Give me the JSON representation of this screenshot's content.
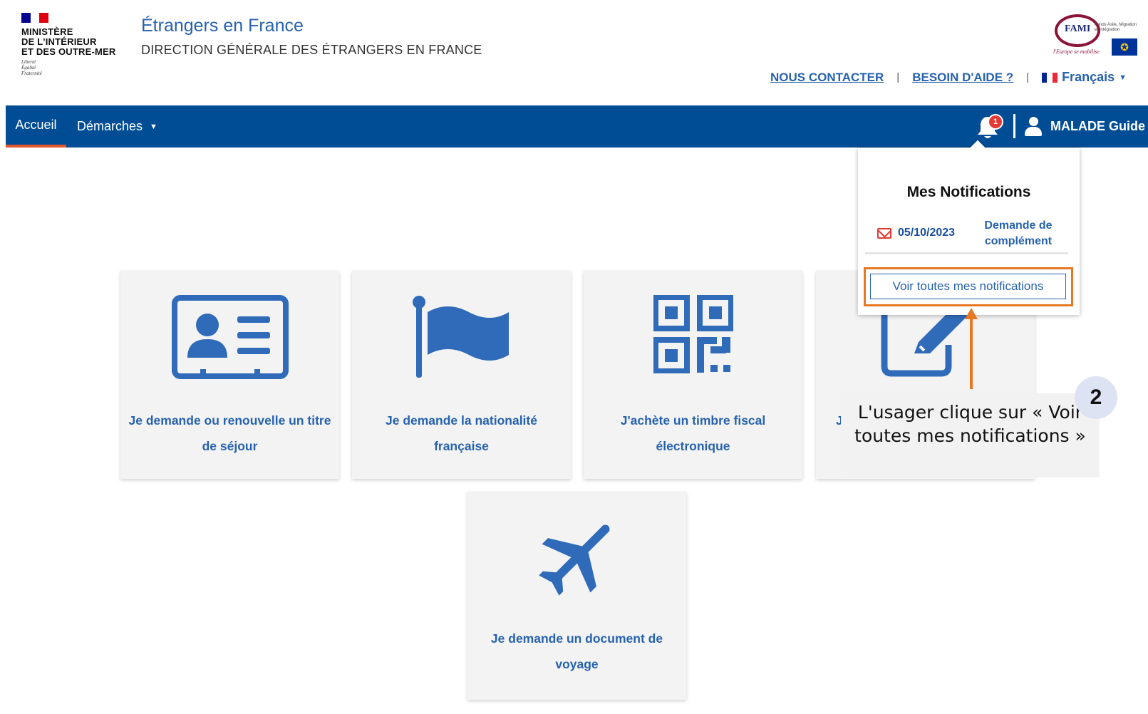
{
  "header": {
    "ministry_lines": [
      "MINISTÈRE",
      "DE L'INTÉRIEUR",
      "ET DES OUTRE-MER"
    ],
    "ministry_devise": [
      "Liberté",
      "Égalité",
      "Fraternité"
    ],
    "site_title": "Étrangers en France",
    "site_subtitle": "DIRECTION GÉNÉRALE DES ÉTRANGERS EN FRANCE",
    "fami_logo": {
      "name": "FAMI",
      "tagline": "Fonds Asile, Migration et Intégration",
      "motto": "l'Europe se mobilise"
    },
    "links": {
      "contact": "NOUS CONTACTER",
      "help": "BESOIN D'AIDE ?",
      "language": "Français"
    }
  },
  "navbar": {
    "home": "Accueil",
    "demarches": "Démarches",
    "notification_count": "1",
    "user_name": "MALADE Guide"
  },
  "cards": [
    {
      "icon": "id-card-icon",
      "label": "Je demande ou renouvelle un titre de séjour"
    },
    {
      "icon": "flag-icon",
      "label": "Je demande la nationalité française"
    },
    {
      "icon": "qr-code-icon",
      "label": "J'achète un timbre fiscal électronique"
    },
    {
      "icon": "edit-icon",
      "label": "J"
    },
    {
      "icon": "airplane-icon",
      "label": "Je demande un document de voyage"
    }
  ],
  "notifications": {
    "title": "Mes Notifications",
    "items": [
      {
        "date": "05/10/2023",
        "type": "Demande de complément"
      }
    ],
    "see_all": "Voir toutes mes notifications"
  },
  "annotation": {
    "step": "2",
    "text": "L'usager clique sur « Voir toutes mes notifications »"
  },
  "colors": {
    "primary": "#2762ae",
    "navbar": "#004c95",
    "highlight": "#e87722",
    "badge": "#e53935"
  }
}
